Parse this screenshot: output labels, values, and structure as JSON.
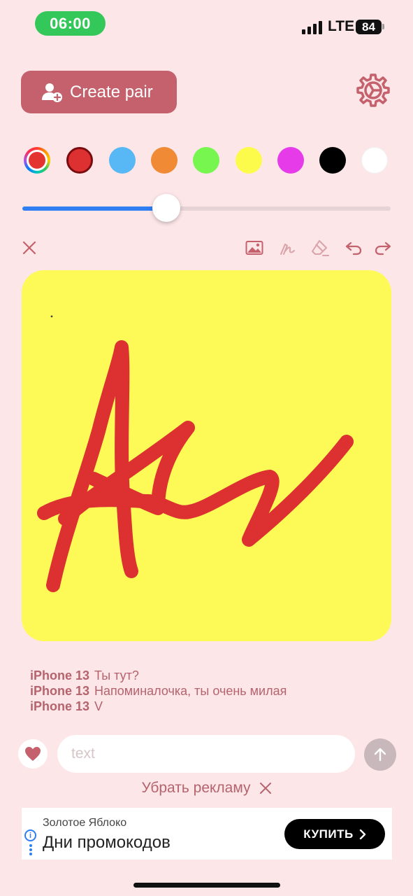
{
  "status_bar": {
    "time": "06:00",
    "network": "LTE",
    "battery": "84"
  },
  "header": {
    "create_pair_label": "Create pair",
    "icons": [
      "add-user-icon",
      "settings-gear-icon"
    ]
  },
  "palette": {
    "colors": [
      "#e3342f",
      "#dc3130",
      "#57b8f5",
      "#f08a34",
      "#77f650",
      "#fcfb4c",
      "#e63be9",
      "#000000",
      "#ffffff"
    ],
    "selected_index": 1
  },
  "brush_size": {
    "level": 0.39
  },
  "toolbar": {
    "icons": [
      "close-icon",
      "image-icon",
      "pen-icon",
      "eraser-icon",
      "undo-icon",
      "redo-icon"
    ]
  },
  "canvas": {
    "background": "#fdfa57",
    "stroke_color": "#dc3130"
  },
  "messages": [
    {
      "sender": "iPhone 13",
      "text": "Ты тут?"
    },
    {
      "sender": "iPhone 13",
      "text": "Напоминалочка, ты очень милая"
    },
    {
      "sender": "iPhone 13",
      "text": "V"
    }
  ],
  "composer": {
    "placeholder": "text"
  },
  "remove_ads_label": "Убрать рекламу",
  "ad": {
    "brand": "Золотое Яблоко",
    "title": "Дни промокодов",
    "cta": "КУПИТЬ"
  },
  "colors": {
    "background": "#fce6e8",
    "accent": "#c4616c",
    "slider": "#2f7ef2"
  }
}
